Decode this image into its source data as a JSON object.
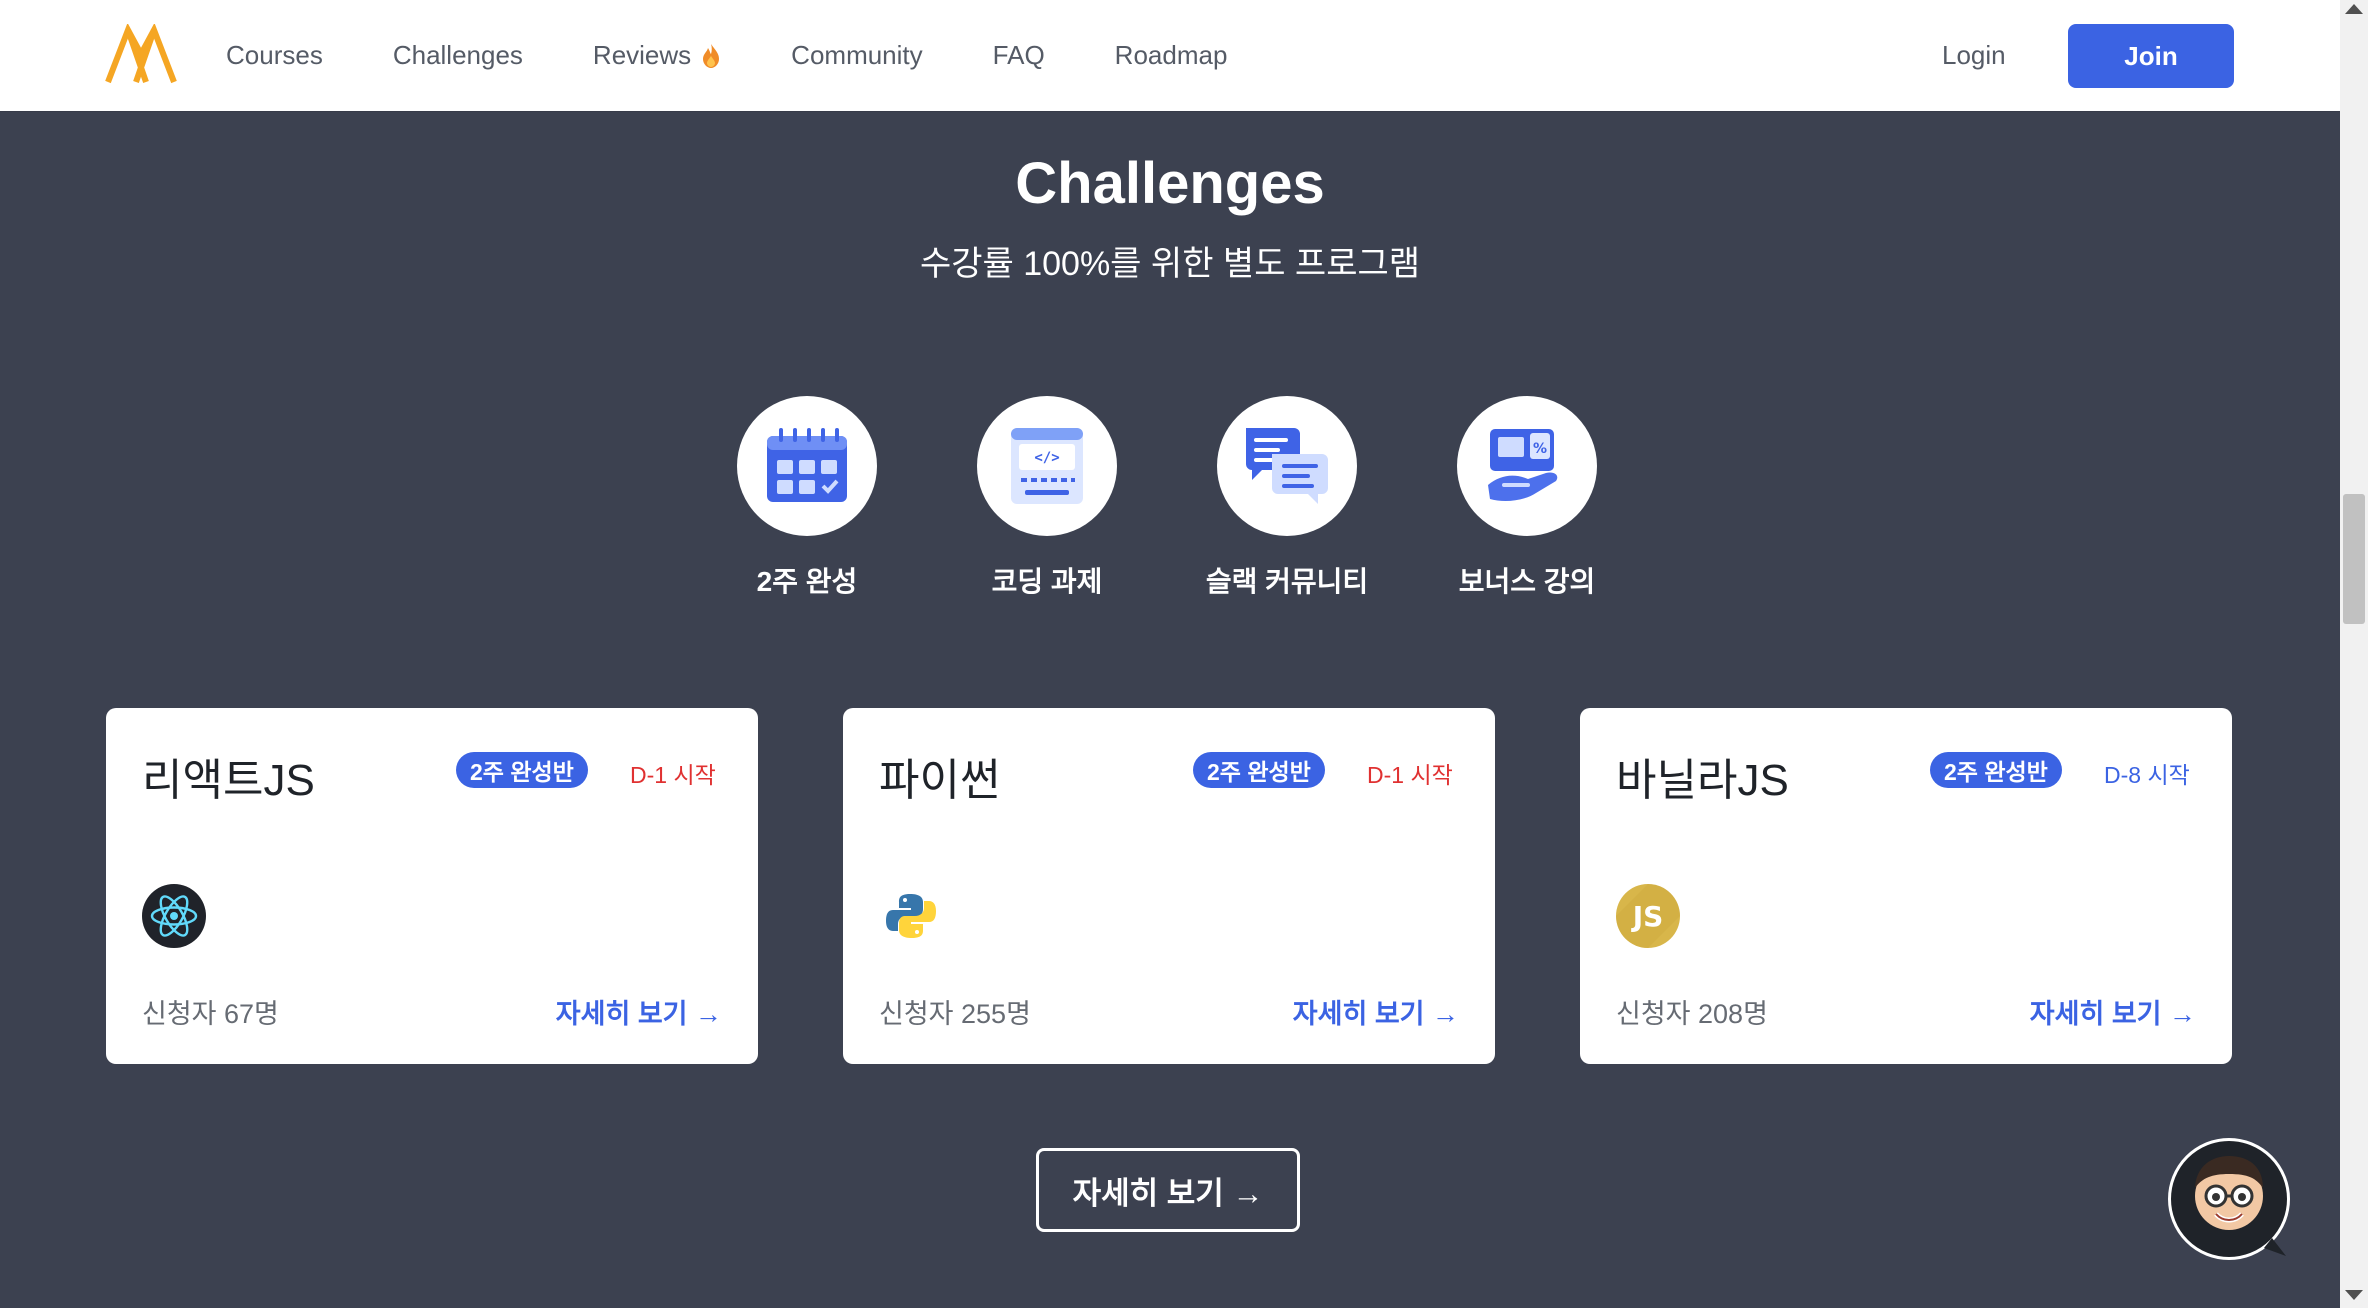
{
  "header": {
    "nav": [
      {
        "label": "Courses"
      },
      {
        "label": "Challenges"
      },
      {
        "label": "Reviews"
      },
      {
        "label": "Community"
      },
      {
        "label": "FAQ"
      },
      {
        "label": "Roadmap"
      }
    ],
    "login": "Login",
    "join": "Join"
  },
  "section": {
    "title": "Challenges",
    "subtitle": "수강률 100%를 위한 별도 프로그램"
  },
  "features": [
    {
      "label": "2주 완성",
      "icon": "calendar-icon"
    },
    {
      "label": "코딩 과제",
      "icon": "code-editor-icon"
    },
    {
      "label": "슬랙 커뮤니티",
      "icon": "chat-bubbles-icon"
    },
    {
      "label": "보너스 강의",
      "icon": "bonus-lecture-icon"
    }
  ],
  "cards": [
    {
      "title": "리액트JS",
      "badge": "2주 완성반",
      "dday": "D-1 시작",
      "dday_color": "#e03131",
      "icon": "react-icon",
      "applicants": "신청자 67명",
      "link": "자세히 보기 →"
    },
    {
      "title": "파이썬",
      "badge": "2주 완성반",
      "dday": "D-1 시작",
      "dday_color": "#e03131",
      "icon": "python-icon",
      "applicants": "신청자 255명",
      "link": "자세히 보기 →"
    },
    {
      "title": "바닐라JS",
      "badge": "2주 완성반",
      "dday": "D-8 시작",
      "dday_color": "#3b63e3",
      "icon": "javascript-icon",
      "applicants": "신청자 208명",
      "link": "자세히 보기 →"
    }
  ],
  "more_button": "자세히 보기 →",
  "colors": {
    "accent": "#3b63e3",
    "background": "#3c4150",
    "logo": "#f5a623"
  }
}
